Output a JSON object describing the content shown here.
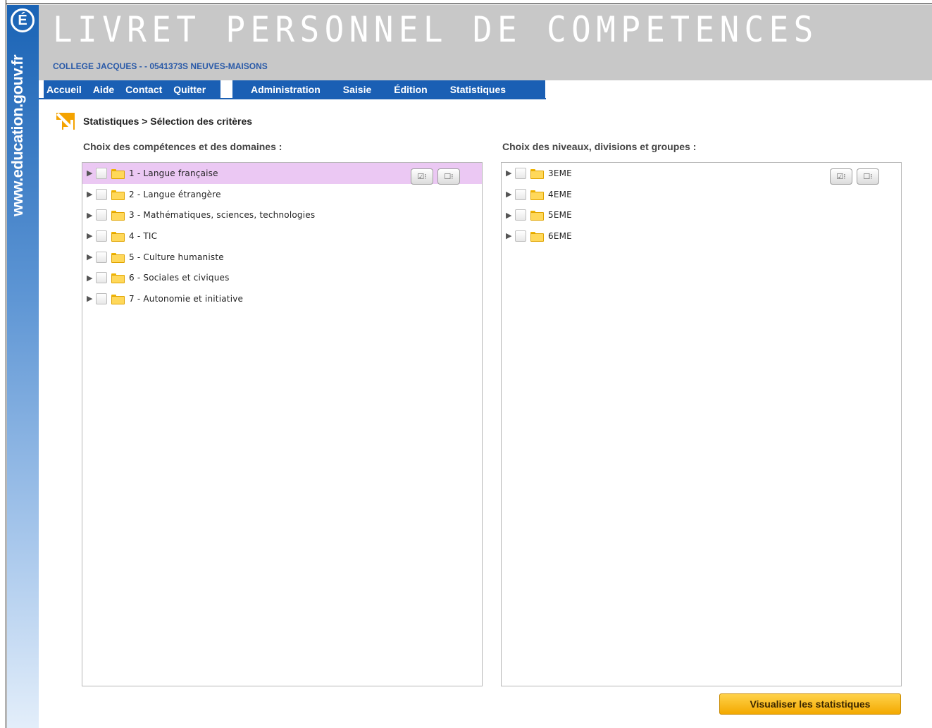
{
  "side": {
    "logo_letter": "É",
    "site": "www.education.gouv.fr"
  },
  "header": {
    "title": "LIVRET PERSONNEL DE COMPETENCES",
    "school": "COLLEGE JACQUES - - 0541373S NEUVES-MAISONS"
  },
  "nav": {
    "left": [
      "Accueil",
      "Aide",
      "Contact",
      "Quitter"
    ],
    "right": [
      "Administration",
      "Saisie",
      "Édition",
      "Statistiques"
    ]
  },
  "breadcrumb": "Statistiques > Sélection des critères",
  "left_panel": {
    "title": "Choix des compétences et des domaines :",
    "items": [
      "1 - Langue française",
      "2 - Langue étrangère",
      "3 - Mathématiques, sciences, technologies",
      "4 - TIC",
      "5 - Culture humaniste",
      "6 - Sociales et civiques",
      "7 - Autonomie et initiative"
    ],
    "highlighted_index": 0
  },
  "right_panel": {
    "title": "Choix des niveaux, divisions et groupes :",
    "items": [
      "3EME",
      "4EME",
      "5EME",
      "6EME"
    ]
  },
  "icons": {
    "select_all": "☑⁝",
    "deselect_all": "☐⁝"
  },
  "action": {
    "label": "Visualiser les statistiques"
  },
  "colors": {
    "nav_blue": "#1a5fb4",
    "highlight": "#ebc8f3",
    "button_orange": "#f3a900"
  }
}
